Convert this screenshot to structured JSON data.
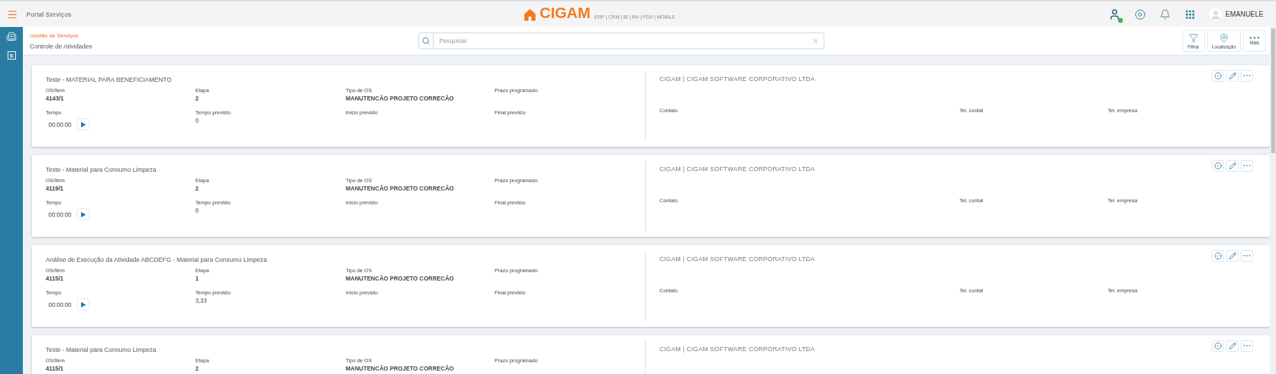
{
  "topbar": {
    "app_title": "Portal Serviços",
    "brand": "CIGAM",
    "tagline": "ERP | CRM | BI | RH | PDV | MOBILE",
    "online": true,
    "user": "EMANUELE"
  },
  "sidebar": {
    "items": [
      {
        "kind": "building"
      },
      {
        "kind": "letter",
        "label": "S"
      }
    ]
  },
  "breadcrumb": {
    "module": "Gestão de Serviços",
    "page": "Controle de Atividades"
  },
  "search": {
    "placeholder": "Pesquisar"
  },
  "actions": [
    {
      "kind": "filter",
      "label": "Filtrar"
    },
    {
      "kind": "location",
      "label": "Localização"
    },
    {
      "kind": "more",
      "label": "Mais"
    }
  ],
  "cards": [
    {
      "title": "Teste - MATERIAL PARA BENEFICIAMENTO",
      "fields": [
        {
          "kind": "text",
          "label": "OS/Item",
          "value": "4143/1"
        },
        {
          "kind": "text",
          "label": "Etapa",
          "value": "2"
        },
        {
          "kind": "text",
          "label": "Tipo de OS",
          "value": "MANUTENCÃO PROJETO CORRECÃO"
        },
        {
          "kind": "text",
          "label": "Prazo programado"
        },
        {
          "kind": "timer",
          "label": "Tempo",
          "value": "00:00:00"
        },
        {
          "kind": "plain",
          "label": "Tempo previsto",
          "value": "0"
        },
        {
          "kind": "text",
          "label": "Início previsto"
        },
        {
          "kind": "text",
          "label": "Final previsto"
        }
      ],
      "company": "CIGAM | CIGAM SOFTWARE CORPORATIVO LTDA",
      "contacts": [
        "Contato",
        "Tel. contat",
        "Tel. empresa"
      ]
    },
    {
      "title": "Teste - Material para Consumo Limpeza",
      "fields": [
        {
          "kind": "text",
          "label": "OS/Item",
          "value": "4119/1"
        },
        {
          "kind": "text",
          "label": "Etapa",
          "value": "2"
        },
        {
          "kind": "text",
          "label": "Tipo de OS",
          "value": "MANUTENCÃO PROJETO CORRECÃO"
        },
        {
          "kind": "text",
          "label": "Prazo programado"
        },
        {
          "kind": "timer",
          "label": "Tempo",
          "value": "00:00:00"
        },
        {
          "kind": "plain",
          "label": "Tempo previsto",
          "value": "0"
        },
        {
          "kind": "text",
          "label": "Início previsto"
        },
        {
          "kind": "text",
          "label": "Final previsto"
        }
      ],
      "company": "CIGAM | CIGAM SOFTWARE CORPORATIVO LTDA",
      "contacts": [
        "Contato",
        "Tel. contat",
        "Tel. empresa"
      ]
    },
    {
      "title": "Análise de Execução da Atividade ABCDEFG - Material para Consumo Limpeza",
      "fields": [
        {
          "kind": "text",
          "label": "OS/Item",
          "value": "4115/1"
        },
        {
          "kind": "text",
          "label": "Etapa",
          "value": "1"
        },
        {
          "kind": "text",
          "label": "Tipo de OS",
          "value": "MANUTENCÃO PROJETO CORRECÃO"
        },
        {
          "kind": "text",
          "label": "Prazo programado"
        },
        {
          "kind": "timer",
          "label": "Tempo",
          "value": "00:00:00"
        },
        {
          "kind": "plain",
          "label": "Tempo previsto",
          "value": "3,33"
        },
        {
          "kind": "text",
          "label": "Início previsto"
        },
        {
          "kind": "text",
          "label": "Final previsto"
        }
      ],
      "company": "CIGAM | CIGAM SOFTWARE CORPORATIVO LTDA",
      "contacts": [
        "Contato",
        "Tel. contat",
        "Tel. empresa"
      ]
    },
    {
      "title": "Teste - Material para Consumo Limpeza",
      "fields": [
        {
          "kind": "text",
          "label": "OS/Item",
          "value": "4115/1"
        },
        {
          "kind": "text",
          "label": "Etapa",
          "value": "2"
        },
        {
          "kind": "text",
          "label": "Tipo de OS",
          "value": "MANUTENCÃO PROJETO CORRECÃO"
        },
        {
          "kind": "text",
          "label": "Prazo programado"
        }
      ],
      "company": "CIGAM | CIGAM SOFTWARE CORPORATIVO LTDA"
    }
  ]
}
